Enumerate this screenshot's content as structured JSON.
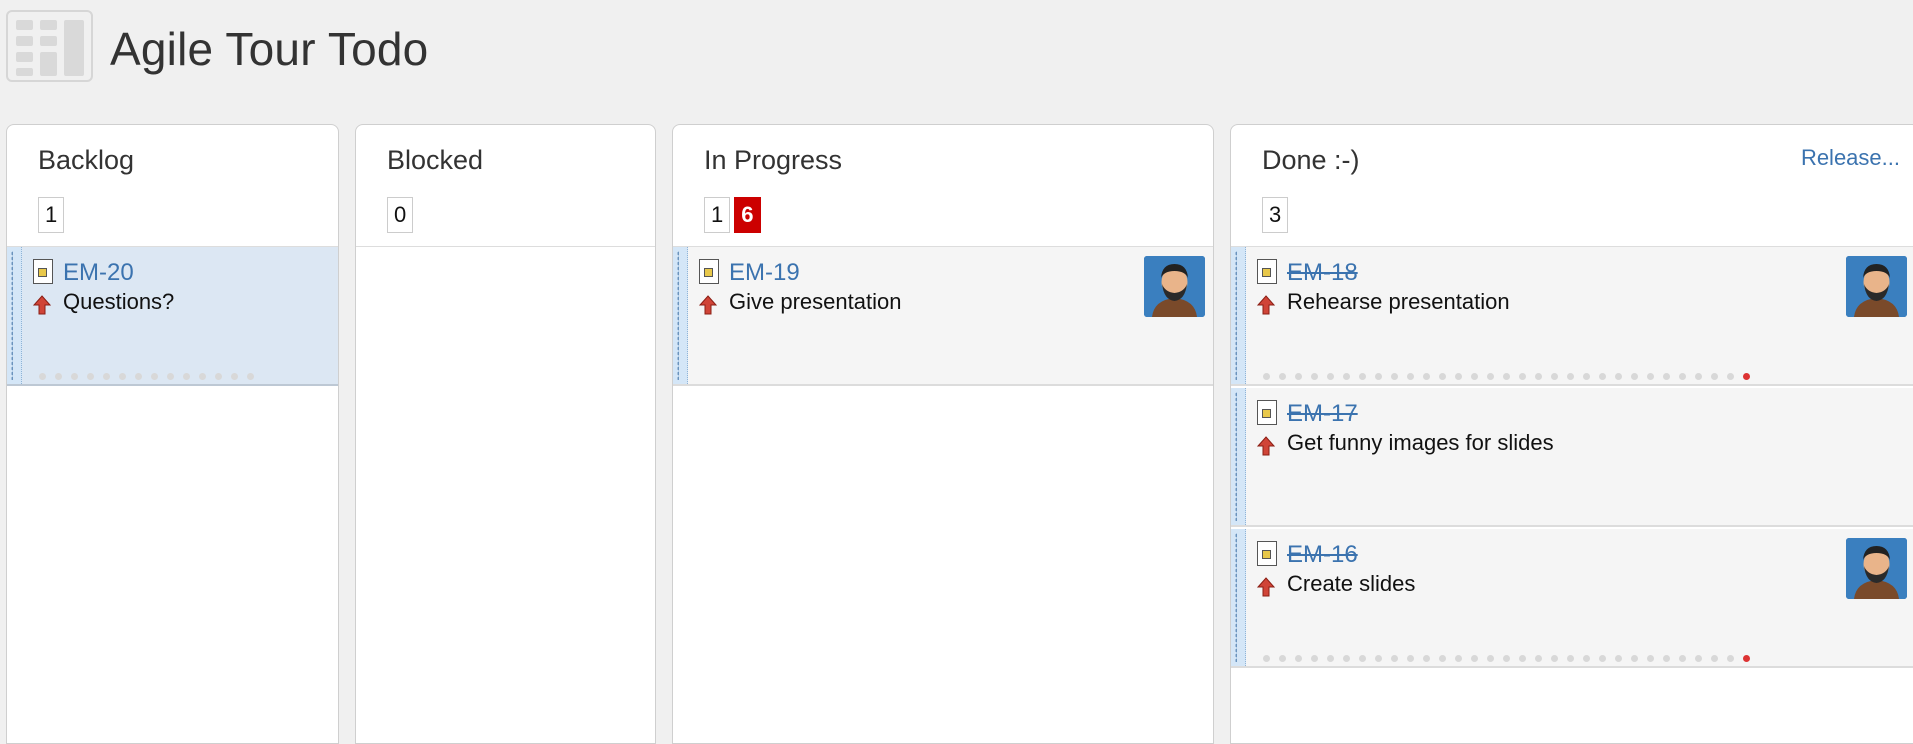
{
  "board": {
    "title": "Agile Tour Todo",
    "columns": [
      {
        "title": "Backlog",
        "counts": [
          "1"
        ],
        "cards": [
          {
            "key": "EM-20",
            "summary": "Questions?"
          }
        ]
      },
      {
        "title": "Blocked",
        "counts": [
          "0"
        ],
        "cards": []
      },
      {
        "title": "In Progress",
        "counts": [
          "1",
          "6"
        ],
        "cards": [
          {
            "key": "EM-19",
            "summary": "Give presentation"
          }
        ]
      },
      {
        "title": "Done :-)",
        "action": "Release...",
        "counts": [
          "3"
        ],
        "cards": [
          {
            "key": "EM-18",
            "summary": "Rehearse presentation"
          },
          {
            "key": "EM-17",
            "summary": "Get funny images for slides"
          },
          {
            "key": "EM-16",
            "summary": "Create slides"
          }
        ]
      }
    ]
  },
  "colors": {
    "link": "#3b73af",
    "max_count_badge": "#cc0000",
    "selected_card": "#dce7f3"
  },
  "icons": {
    "board": "board-icon",
    "issue_type": "task-icon",
    "priority": "priority-major-icon",
    "assignee": "user-avatar"
  }
}
